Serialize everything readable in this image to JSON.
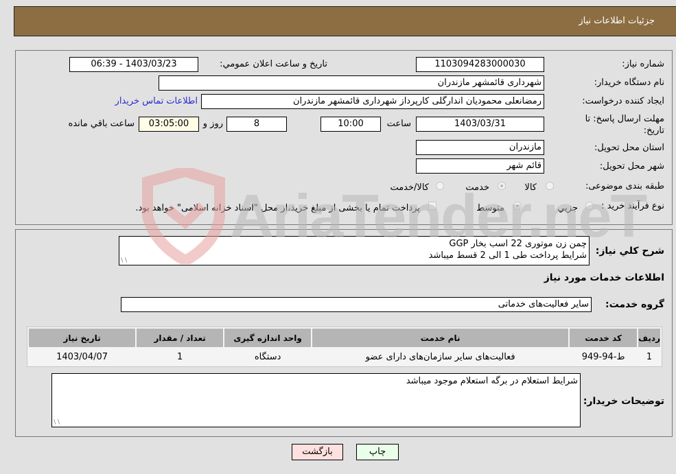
{
  "header": {
    "title": "جزئیات اطلاعات نیاز"
  },
  "info": {
    "need_number_label": "شماره نیاز:",
    "need_number": "1103094283000030",
    "announce_label": "تاریخ و ساعت اعلان عمومي:",
    "announce_value": "1403/03/23 - 06:39",
    "buyer_org_label": "نام دستگاه خریدار:",
    "buyer_org": "شهرداری قائمشهر مازندران",
    "creator_label": "ایجاد کننده درخواست:",
    "creator": "رمضانعلی محمودیان اندارگلی کارپرداز شهرداری قائمشهر مازندران",
    "contact_link": "اطلاعات تماس خریدار",
    "deadline_label_1": "مهلت ارسال پاسخ: تا",
    "deadline_label_2": "تاریخ:",
    "deadline_date": "1403/03/31",
    "time_label": "ساعت",
    "deadline_time": "10:00",
    "days_value": "8",
    "days_label": "روز و",
    "remaining_time": "03:05:00",
    "remaining_label": "ساعت باقي مانده",
    "province_label": "استان محل تحویل:",
    "province": "مازندران",
    "city_label": "شهر محل تحویل:",
    "city": "قائم شهر",
    "category_label": "طبقه بندی موضوعی:",
    "category_options": [
      {
        "label": "کالا",
        "selected": false
      },
      {
        "label": "خدمت",
        "selected": true
      },
      {
        "label": "کالا/خدمت",
        "selected": false
      }
    ],
    "process_label": "نوع فرآیند خرید :",
    "process_options": [
      {
        "label": "جزيي",
        "selected": false
      },
      {
        "label": "متوسط",
        "selected": true
      }
    ],
    "treasury_checkbox_label": "پرداخت تمام یا بخشی از مبلغ خرید،از محل \"اسناد خزانه اسلامی\" خواهد بود.",
    "treasury_checked": false
  },
  "details": {
    "description_label": "شرح کلي نیاز:",
    "description_line1": "چمن زن موتوری 22 اسب بخار GGP",
    "description_line2": "شرایط پرداخت طی 1 الی 2 قسط میباشد",
    "services_heading": "اطلاعات خدمات مورد نیاز",
    "service_group_label": "گروه خدمت:",
    "service_group": "سایر فعالیت‌های خدماتی",
    "table": {
      "headers": [
        "ردیف",
        "کد خدمت",
        "نام خدمت",
        "واحد اندازه گیری",
        "تعداد / مقدار",
        "تاریخ نیاز"
      ],
      "rows": [
        [
          "1",
          "ط-94-949",
          "فعالیت‌های سایر سازمان‌های دارای عضو",
          "دستگاه",
          "1",
          "1403/04/07"
        ]
      ]
    },
    "buyer_notes_label": "توضیحات خریدار:",
    "buyer_notes": "شرایط استعلام در برگه استعلام موجود میباشد"
  },
  "buttons": {
    "print": "چاپ",
    "back": "بازگشت"
  },
  "watermark": {
    "text": "AriaTender.neT"
  },
  "colors": {
    "header_bg": "#8d6e42",
    "link": "#2b2bd0",
    "print_bg": "#eaffea",
    "back_bg": "#ffe0e0"
  }
}
